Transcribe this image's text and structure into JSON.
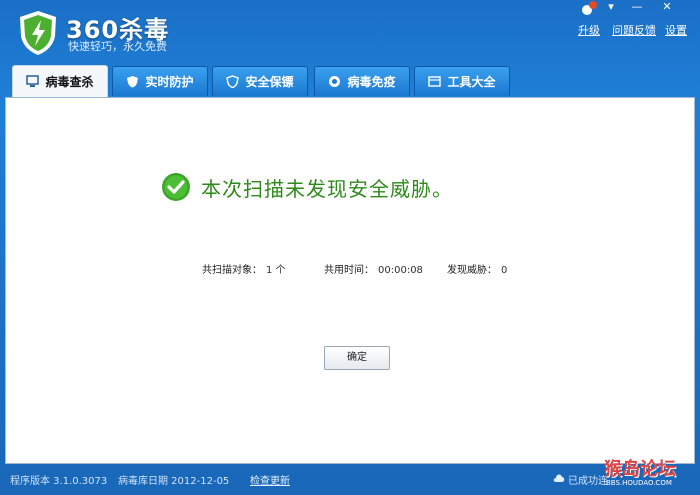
{
  "app": {
    "title": "360杀毒",
    "slogan": "快速轻巧，永久免费"
  },
  "top_links": {
    "upgrade": "升级",
    "feedback": "问题反馈",
    "settings": "设置"
  },
  "window_controls": {
    "menu": "▾",
    "minimize": "—",
    "close": "✕"
  },
  "tabs": [
    {
      "label": "病毒查杀",
      "active": true
    },
    {
      "label": "实时防护",
      "active": false
    },
    {
      "label": "安全保镖",
      "active": false
    },
    {
      "label": "病毒免疫",
      "active": false
    },
    {
      "label": "工具大全",
      "active": false
    }
  ],
  "result": {
    "message": "本次扫描未发现安全威胁。"
  },
  "stats": {
    "scanned_label": "共扫描对象：",
    "scanned_value": "1 个",
    "time_label": "共用时间：",
    "time_value": "00:00:08",
    "threats_label": "发现威胁：",
    "threats_value": "0"
  },
  "ok_button": "确定",
  "status_bar": {
    "version": "程序版本 3.1.0.3073",
    "db_date": "病毒库日期 2012-12-05",
    "check_update": "检查更新",
    "connected": "已成功连"
  },
  "watermark": {
    "text": "猴岛论坛",
    "sub": "BBS.HOUDAO.COM"
  },
  "colors": {
    "accent": "#1b6fc6",
    "success": "#2e8a1a"
  }
}
